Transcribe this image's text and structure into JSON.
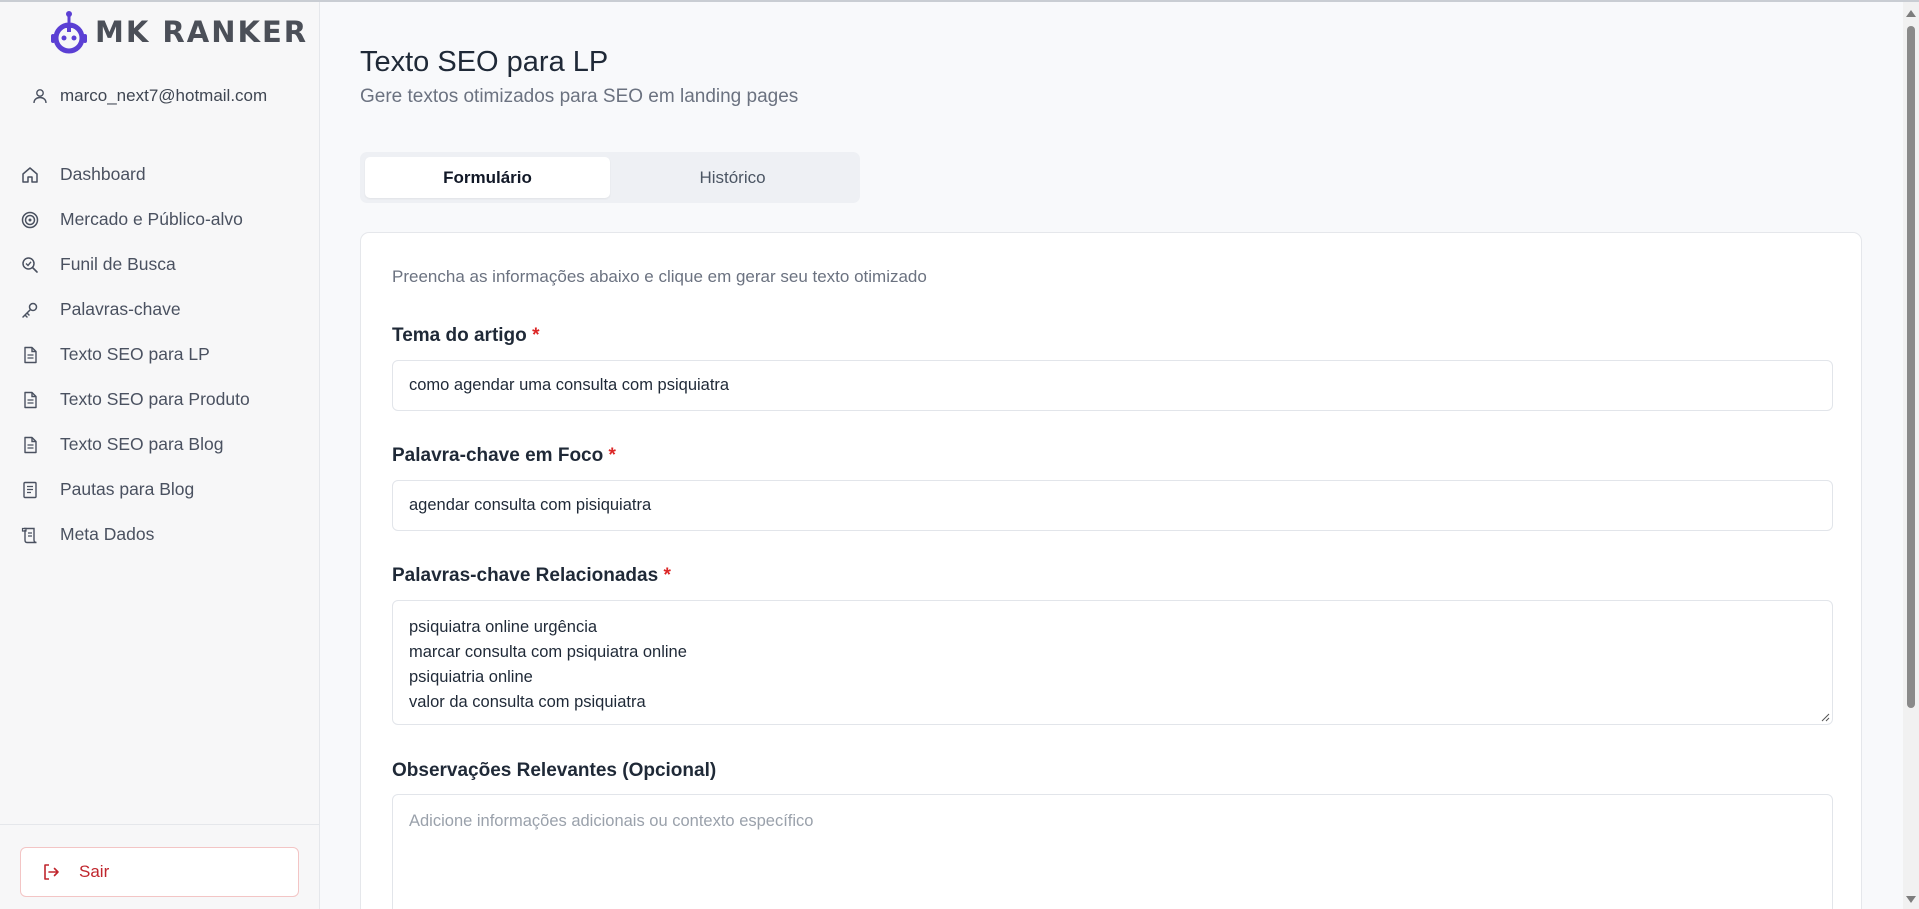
{
  "app": {
    "logo_text": "MK RANKER",
    "brand_color": "#5b3fd4",
    "user_email": "marco_next7@hotmail.com"
  },
  "sidebar": {
    "items": [
      {
        "label": "Dashboard",
        "icon": "home-icon"
      },
      {
        "label": "Mercado e Público-alvo",
        "icon": "target-icon"
      },
      {
        "label": "Funil de Busca",
        "icon": "search-check-icon"
      },
      {
        "label": "Palavras-chave",
        "icon": "key-icon"
      },
      {
        "label": "Texto SEO para LP",
        "icon": "document-icon"
      },
      {
        "label": "Texto SEO para Produto",
        "icon": "document-icon"
      },
      {
        "label": "Texto SEO para Blog",
        "icon": "document-icon"
      },
      {
        "label": "Pautas para Blog",
        "icon": "notebook-icon"
      },
      {
        "label": "Meta Dados",
        "icon": "scroll-icon"
      }
    ],
    "logout_label": "Sair"
  },
  "header": {
    "title": "Texto SEO para LP",
    "subtitle": "Gere textos otimizados para SEO em landing pages"
  },
  "tabs": [
    {
      "label": "Formulário",
      "active": true
    },
    {
      "label": "Histórico",
      "active": false
    }
  ],
  "form": {
    "intro": "Preencha as informações abaixo e clique em gerar seu texto otimizado",
    "required_marker": "*",
    "tema": {
      "label": "Tema do artigo",
      "value": "como agendar uma consulta com psiquiatra"
    },
    "palavra_foco": {
      "label": "Palavra-chave em Foco",
      "value": "agendar consulta com pisiquiatra"
    },
    "relacionadas": {
      "label": "Palavras-chave Relacionadas",
      "lines": [
        "psiquiatra online urgência",
        "marcar consulta com psiquiatra online",
        "psiquiatria online",
        "valor da consulta com psiquiatra"
      ]
    },
    "observacoes": {
      "label": "Observações Relevantes (Opcional)",
      "placeholder": "Adicione informações adicionais ou contexto específico"
    }
  }
}
